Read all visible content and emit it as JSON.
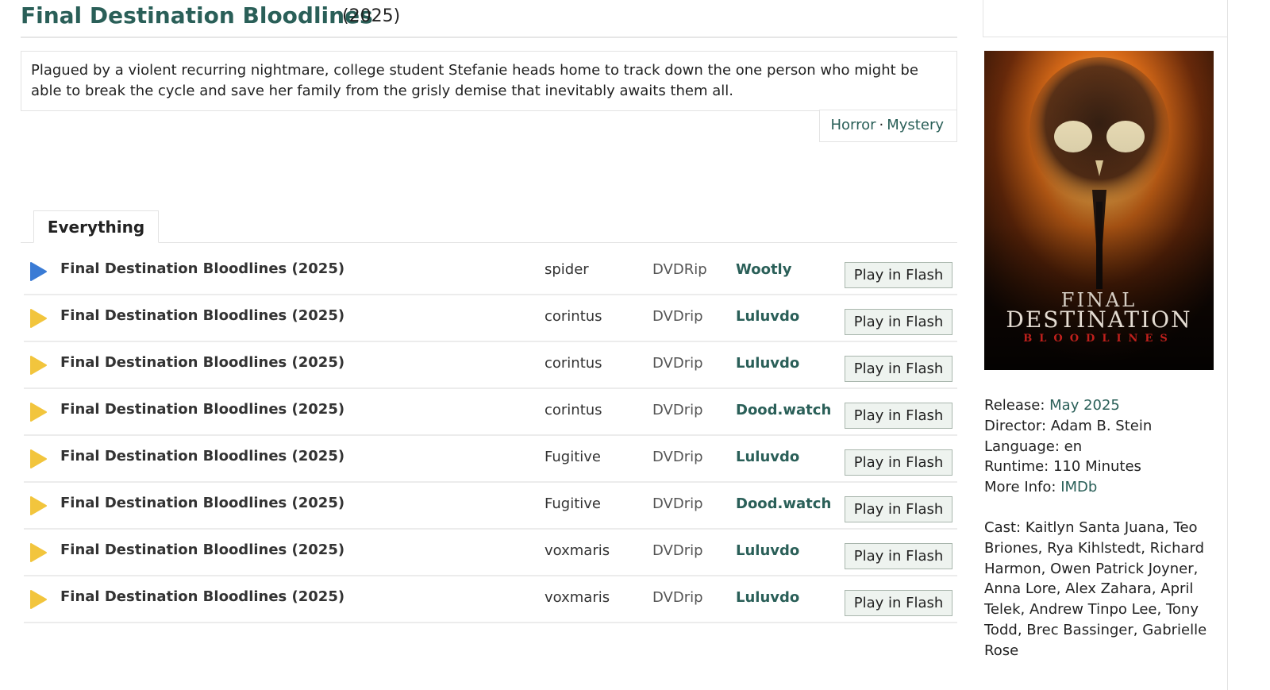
{
  "movie": {
    "title": "Final Destination Bloodlines",
    "year": "(2025)",
    "synopsis": "Plagued by a violent recurring nightmare, college student Stefanie heads home to track down the one person who might be able to break the cycle and save her family from the grisly demise that inevitably awaits them all.",
    "genres": [
      "Horror",
      "Mystery"
    ],
    "genre_separator": "·"
  },
  "tabs": [
    {
      "label": "Everything"
    }
  ],
  "rows": [
    {
      "name": "Final Destination Bloodlines (2025)",
      "uploader": "spider",
      "quality": "DVDRip",
      "host": "Wootly",
      "button": "Play in Flash",
      "icon": "play-icon-blue"
    },
    {
      "name": "Final Destination Bloodlines (2025)",
      "uploader": "corintus",
      "quality": "DVDrip",
      "host": "Luluvdo",
      "button": "Play in Flash",
      "icon": "play-icon-yellow"
    },
    {
      "name": "Final Destination Bloodlines (2025)",
      "uploader": "corintus",
      "quality": "DVDrip",
      "host": "Luluvdo",
      "button": "Play in Flash",
      "icon": "play-icon-yellow"
    },
    {
      "name": "Final Destination Bloodlines (2025)",
      "uploader": "corintus",
      "quality": "DVDrip",
      "host": "Dood.watch",
      "button": "Play in Flash",
      "icon": "play-icon-yellow"
    },
    {
      "name": "Final Destination Bloodlines (2025)",
      "uploader": "Fugitive",
      "quality": "DVDrip",
      "host": "Luluvdo",
      "button": "Play in Flash",
      "icon": "play-icon-yellow"
    },
    {
      "name": "Final Destination Bloodlines (2025)",
      "uploader": "Fugitive",
      "quality": "DVDrip",
      "host": "Dood.watch",
      "button": "Play in Flash",
      "icon": "play-icon-yellow"
    },
    {
      "name": "Final Destination Bloodlines (2025)",
      "uploader": "voxmaris",
      "quality": "DVDrip",
      "host": "Luluvdo",
      "button": "Play in Flash",
      "icon": "play-icon-yellow"
    },
    {
      "name": "Final Destination Bloodlines (2025)",
      "uploader": "voxmaris",
      "quality": "DVDrip",
      "host": "Luluvdo",
      "button": "Play in Flash",
      "icon": "play-icon-yellow"
    }
  ],
  "poster": {
    "line1": "FINAL",
    "line2": "DESTINATION",
    "line3": "BLOODLINES"
  },
  "info": {
    "release_label": "Release:",
    "release_value": "May 2025",
    "director_label": "Director:",
    "director_value": "Adam B. Stein",
    "language_label": "Language:",
    "language_value": "en",
    "runtime_label": "Runtime:",
    "runtime_value": "110 Minutes",
    "more_label": "More Info:",
    "more_value": "IMDb"
  },
  "cast": {
    "label": "Cast:",
    "names": [
      "Kaitlyn Santa Juana",
      "Teo Briones",
      "Rya Kihlstedt",
      "Richard Harmon",
      "Owen Patrick Joyner",
      "Anna Lore",
      "Alex Zahara",
      "April Telek",
      "Andrew Tinpo Lee",
      "Tony Todd",
      "Brec Bassinger",
      "Gabrielle Rose"
    ]
  },
  "colors": {
    "accent": "#2a5f58",
    "play_blue": "#3a7bd5",
    "play_yellow": "#f2c53d",
    "button_bg": "#eef3ef"
  }
}
